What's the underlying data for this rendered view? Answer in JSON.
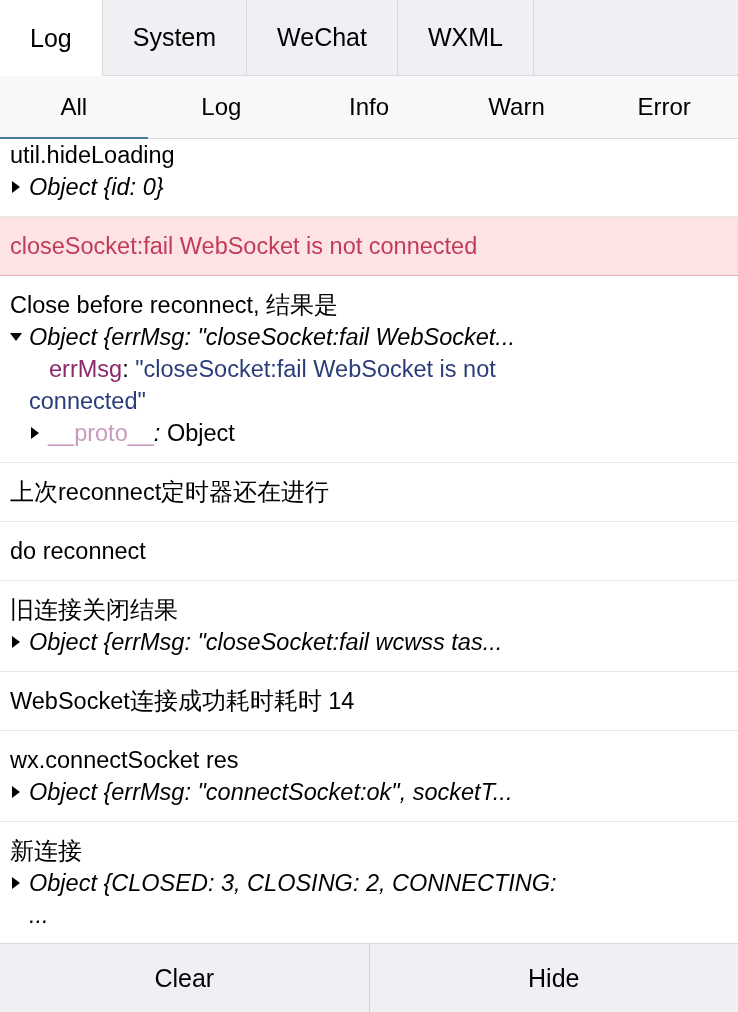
{
  "tabs": [
    {
      "label": "Log",
      "selected": true
    },
    {
      "label": "System",
      "selected": false
    },
    {
      "label": "WeChat",
      "selected": false
    },
    {
      "label": "WXML",
      "selected": false
    }
  ],
  "filters": [
    {
      "label": "All",
      "selected": true
    },
    {
      "label": "Log",
      "selected": false
    },
    {
      "label": "Info",
      "selected": false
    },
    {
      "label": "Warn",
      "selected": false
    },
    {
      "label": "Error",
      "selected": false
    }
  ],
  "entries": [
    {
      "kind": "log",
      "text": "util.hideLoading",
      "objects": [
        {
          "summary": "Object {id: 0}",
          "expanded": false
        }
      ]
    },
    {
      "kind": "error",
      "text": "closeSocket:fail WebSocket is not connected"
    },
    {
      "kind": "log",
      "text": "Close before reconnect, 结果是",
      "objects": [
        {
          "summary": "Object {errMsg: \"closeSocket:fail WebSocket...",
          "expanded": true,
          "children": [
            {
              "kind": "property",
              "key": "errMsg",
              "separator": ": ",
              "value": "\"closeSocket:fail WebSocket is not connected\""
            },
            {
              "kind": "prototype",
              "key": "__proto__",
              "separator": ": ",
              "value": "Object",
              "expanded": false
            }
          ]
        }
      ]
    },
    {
      "kind": "log",
      "text": "上次reconnect定时器还在进行"
    },
    {
      "kind": "log",
      "text": "do reconnect"
    },
    {
      "kind": "log",
      "text": "旧连接关闭结果",
      "objects": [
        {
          "summary": "Object {errMsg: \"closeSocket:fail wcwss tas...",
          "expanded": false
        }
      ]
    },
    {
      "kind": "log",
      "text": "WebSocket连接成功耗时耗时 14"
    },
    {
      "kind": "log",
      "text": "wx.connectSocket res",
      "objects": [
        {
          "summary": "Object {errMsg: \"connectSocket:ok\", socketT...",
          "expanded": false
        }
      ]
    },
    {
      "kind": "log",
      "text": "新连接",
      "objects": [
        {
          "summary": "Object {CLOSED: 3, CLOSING: 2, CONNECTING: ...",
          "expanded": false
        }
      ]
    }
  ],
  "footer": [
    {
      "label": "Clear"
    },
    {
      "label": "Hide"
    }
  ]
}
